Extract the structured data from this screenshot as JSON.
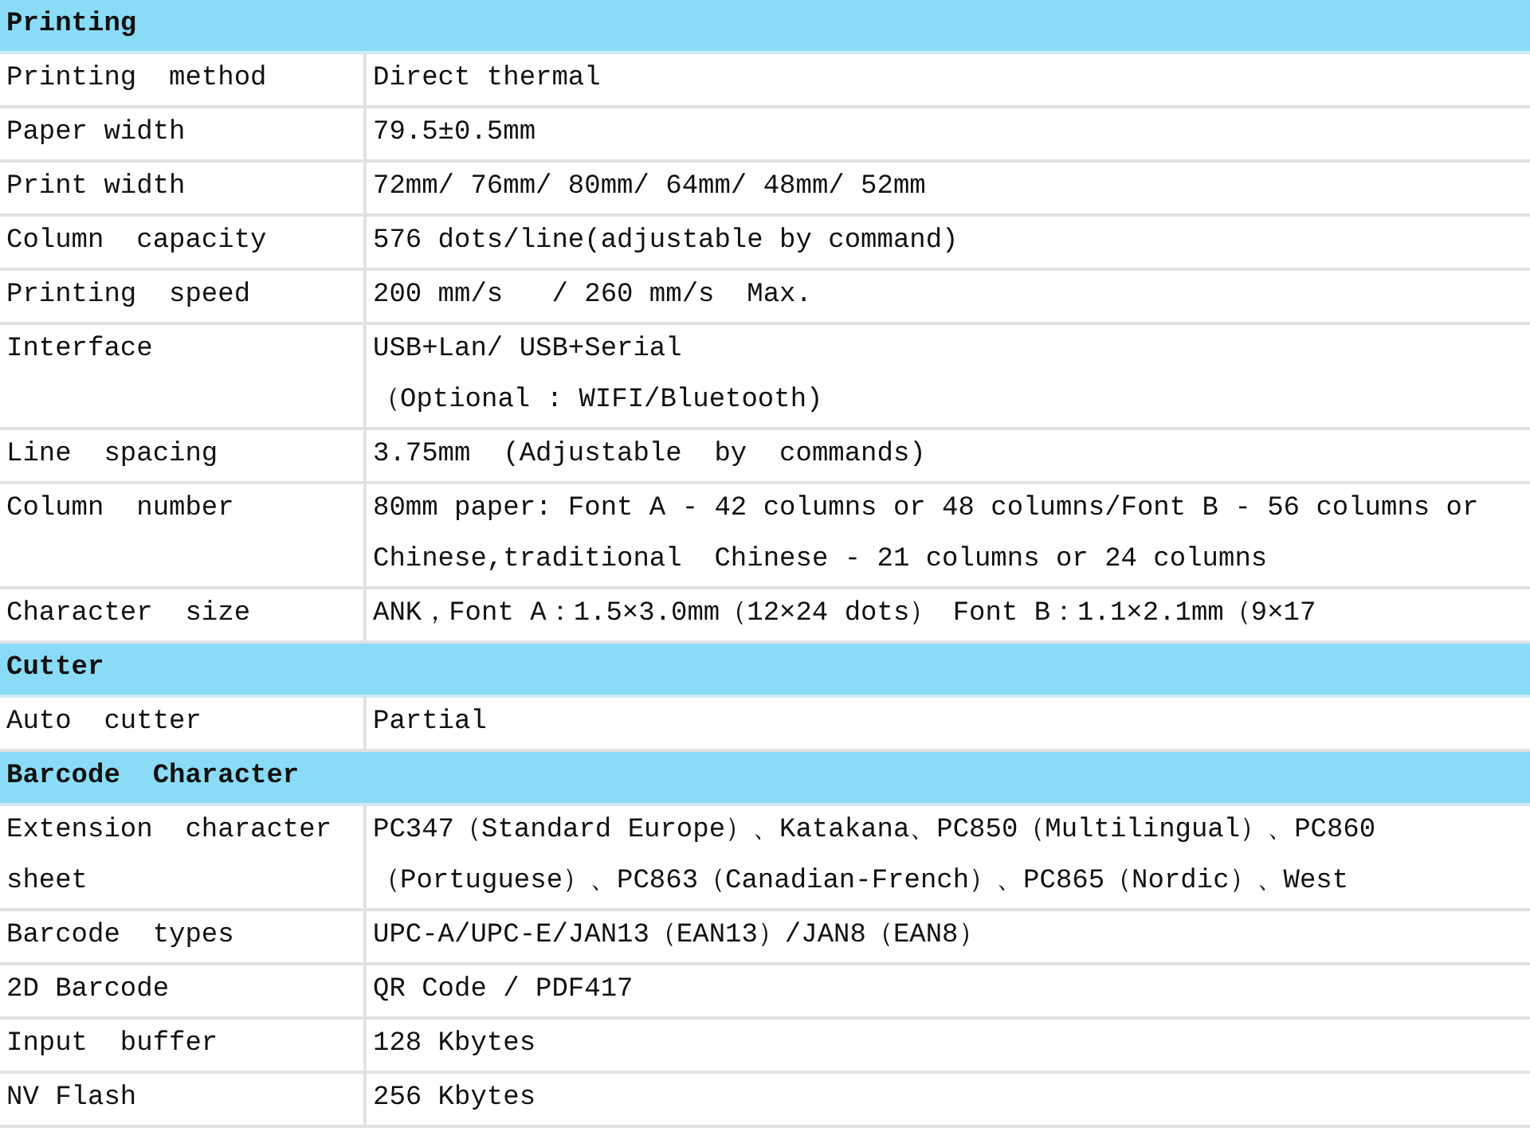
{
  "sections": [
    {
      "title": "Printing",
      "rows": [
        {
          "label": "Printing  method",
          "lines": [
            "Direct thermal"
          ]
        },
        {
          "label": "Paper width",
          "lines": [
            "79.5±0.5mm"
          ]
        },
        {
          "label": "Print width",
          "lines": [
            "72mm/ 76mm/ 80mm/ 64mm/ 48mm/ 52mm"
          ]
        },
        {
          "label": "Column  capacity",
          "lines": [
            "576 dots/line(adjustable by command)"
          ]
        },
        {
          "label": "Printing  speed",
          "lines": [
            "200 mm/s   / 260 mm/s  Max."
          ]
        },
        {
          "label": "Interface",
          "lines": [
            "USB+Lan/ USB+Serial",
            "（Optional : WIFI/Bluetooth)"
          ]
        },
        {
          "label": "Line  spacing",
          "lines": [
            "3.75mm  (Adjustable  by  commands)"
          ]
        },
        {
          "label": "Column  number",
          "lines": [
            "80mm paper: Font A - 42 columns or 48 columns/Font B - 56 columns or",
            "Chinese,traditional  Chinese - 21 columns or 24 columns"
          ]
        },
        {
          "label": "Character  size",
          "lines": [
            "ANK，Font A：1.5×3.0mm（12×24 dots） Font B：1.1×2.1mm（9×17"
          ]
        }
      ]
    },
    {
      "title": "Cutter",
      "rows": [
        {
          "label": "Auto  cutter",
          "lines": [
            "Partial"
          ]
        }
      ]
    },
    {
      "title": "Barcode  Character",
      "rows": [
        {
          "label": "Extension  character  sheet",
          "lines": [
            "PC347（Standard Europe）、Katakana、PC850（Multilingual）、PC860",
            "（Portuguese）、PC863（Canadian-French）、PC865（Nordic）、West"
          ]
        },
        {
          "label": "Barcode  types",
          "lines": [
            "UPC-A/UPC-E/JAN13（EAN13）/JAN8（EAN8）"
          ]
        },
        {
          "label": "2D Barcode",
          "lines": [
            "QR Code / PDF417"
          ]
        },
        {
          "label": "Input  buffer",
          "lines": [
            "128 Kbytes"
          ]
        },
        {
          "label": "NV Flash",
          "lines": [
            "256 Kbytes"
          ]
        }
      ]
    }
  ]
}
